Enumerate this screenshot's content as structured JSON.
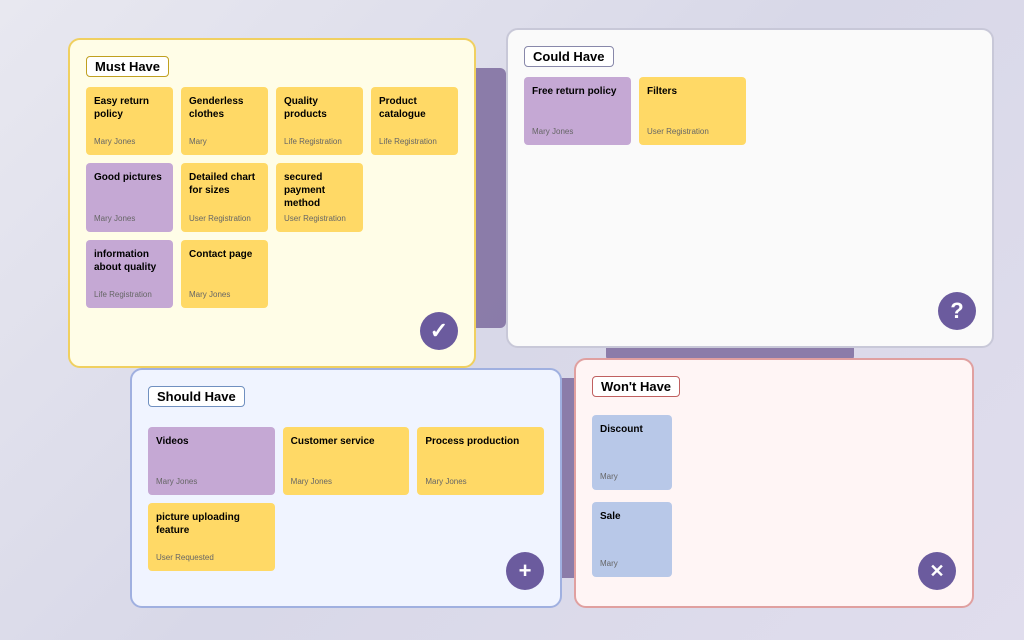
{
  "quadrants": {
    "must_have": {
      "title": "Must Have",
      "cards": [
        {
          "label": "Easy return policy",
          "meta": "Mary Jones",
          "color": "sticky-yellow"
        },
        {
          "label": "Genderless clothes",
          "meta": "Mary",
          "color": "sticky-yellow"
        },
        {
          "label": "Quality products",
          "meta": "Life Registration",
          "color": "sticky-yellow"
        },
        {
          "label": "Product catalogue",
          "meta": "Life Registration",
          "color": "sticky-yellow"
        },
        {
          "label": "Good pictures",
          "meta": "Mary Jones",
          "color": "sticky-purple"
        },
        {
          "label": "Detailed chart for sizes",
          "meta": "User Registration",
          "color": "sticky-yellow"
        },
        {
          "label": "secured payment method",
          "meta": "User Registration",
          "color": "sticky-yellow"
        },
        {
          "label": "",
          "meta": "",
          "color": ""
        },
        {
          "label": "information about quality",
          "meta": "Life Registration",
          "color": "sticky-purple"
        },
        {
          "label": "Contact page",
          "meta": "Mary Jones",
          "color": "sticky-yellow"
        },
        {
          "label": "",
          "meta": "",
          "color": ""
        },
        {
          "label": "",
          "meta": "",
          "color": ""
        }
      ]
    },
    "could_have": {
      "title": "Could Have",
      "cards": [
        {
          "label": "Free return policy",
          "meta": "Mary Jones",
          "color": "sticky-purple"
        },
        {
          "label": "Filters",
          "meta": "User Registration",
          "color": "sticky-yellow"
        },
        {
          "label": "",
          "meta": "",
          "color": ""
        },
        {
          "label": "",
          "meta": "",
          "color": ""
        }
      ]
    },
    "should_have": {
      "title": "Should Have",
      "cards": [
        {
          "label": "Videos",
          "meta": "Mary Jones",
          "color": "sticky-purple"
        },
        {
          "label": "Customer service",
          "meta": "Mary Jones",
          "color": "sticky-yellow"
        },
        {
          "label": "Process production",
          "meta": "Mary Jones",
          "color": "sticky-yellow"
        },
        {
          "label": "picture uploading feature",
          "meta": "User Requested",
          "color": "sticky-yellow"
        }
      ]
    },
    "wont_have": {
      "title": "Won't Have",
      "cards": [
        {
          "label": "Discount",
          "meta": "Mary",
          "color": "sticky-blue"
        },
        {
          "label": "Sale",
          "meta": "Mary",
          "color": "sticky-blue"
        }
      ]
    }
  },
  "buttons": {
    "must_have_icon": "✓",
    "could_have_icon": "?",
    "should_have_icon": "+",
    "wont_have_icon": "✕"
  }
}
